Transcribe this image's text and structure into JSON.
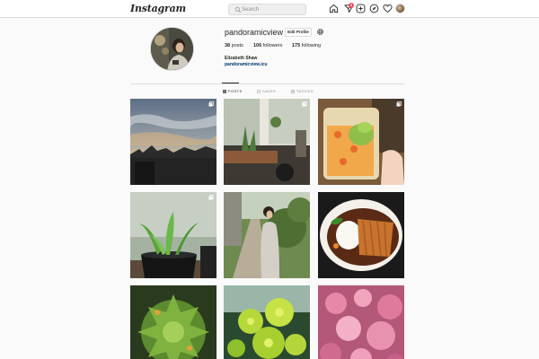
{
  "header": {
    "logo": "Instagram",
    "search_placeholder": "Search",
    "notification_count": "1",
    "icons": [
      "home-icon",
      "direct-icon",
      "new-post-icon",
      "explore-icon",
      "activity-heart-icon",
      "profile-avatar"
    ]
  },
  "profile": {
    "username": "pandoramicview",
    "edit_button": "Edit Profile",
    "stats": {
      "posts_count": "38",
      "posts_label": "posts",
      "followers_count": "106",
      "followers_label": "followers",
      "following_count": "175",
      "following_label": "following"
    },
    "full_name": "Elizabeth Shaw",
    "website": "pandoramicview.icu"
  },
  "tabs": [
    {
      "label": "POSTS",
      "active": true
    },
    {
      "label": "SAVED",
      "active": false
    },
    {
      "label": "TAGGED",
      "active": false
    }
  ],
  "posts": [
    {
      "subject": "sunset sky over rooftops",
      "multi": true
    },
    {
      "subject": "windowsill plants and teapot",
      "multi": true
    },
    {
      "subject": "matcha ice cream dessert",
      "multi": true
    },
    {
      "subject": "seedlings in black pot",
      "multi": true
    },
    {
      "subject": "woman on garden path",
      "multi": false
    },
    {
      "subject": "katsu curry plate",
      "multi": false
    },
    {
      "subject": "succulent rosette",
      "multi": false
    },
    {
      "subject": "green euphorbia flowers",
      "multi": false
    },
    {
      "subject": "pink blossoms",
      "multi": false
    }
  ],
  "colors": {
    "accent_link": "#003569",
    "badge": "#ed4956",
    "border": "#dbdbdb",
    "background": "#fafafa"
  }
}
